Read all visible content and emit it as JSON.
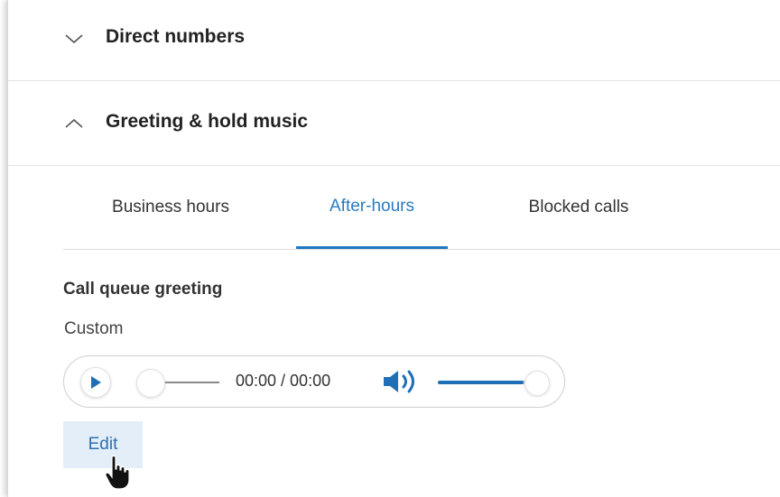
{
  "sections": {
    "direct_numbers": {
      "title": "Direct numbers",
      "expanded": false,
      "icon": "chevron-down-icon"
    },
    "greeting": {
      "title": "Greeting & hold music",
      "expanded": true,
      "icon": "chevron-up-icon"
    }
  },
  "tabs": [
    {
      "label": "Business hours",
      "active": false
    },
    {
      "label": "After-hours",
      "active": true
    },
    {
      "label": "Blocked calls",
      "active": false
    }
  ],
  "greeting": {
    "label": "Call queue greeting",
    "value": "Custom"
  },
  "player": {
    "time": "00:00 / 00:00",
    "progress": 0,
    "volume": 0.95,
    "play_icon": "play-icon",
    "volume_icon": "volume-icon"
  },
  "edit_label": "Edit",
  "colors": {
    "accent": "#1f78c1",
    "edit_bg": "#e4eef8",
    "text": "#222222"
  }
}
